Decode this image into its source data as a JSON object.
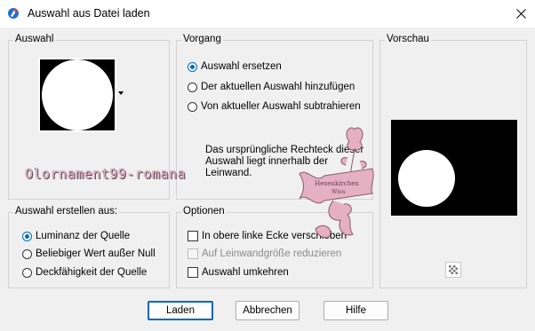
{
  "window": {
    "title": "Auswahl aus Datei laden"
  },
  "auswahl": {
    "title": "Auswahl",
    "dropdown_arrow": "caret-down-icon"
  },
  "vorgang": {
    "title": "Vorgang",
    "options": [
      {
        "label": "Auswahl ersetzen",
        "checked": true
      },
      {
        "label": "Der aktuellen Auswahl hinzufügen",
        "checked": false
      },
      {
        "label": "Von aktueller Auswahl subtrahieren",
        "checked": false
      }
    ],
    "info_line1": "Das ursprüngliche Rechteck dieser",
    "info_line2": "Auswahl liegt innerhalb der",
    "info_line3": "Leinwand."
  },
  "vorschau": {
    "title": "Vorschau",
    "zoom_icon": "checkerboard-icon"
  },
  "erstellen": {
    "title": "Auswahl erstellen aus:",
    "options": [
      {
        "label": "Luminanz der Quelle",
        "checked": true
      },
      {
        "label": "Beliebiger Wert außer Null",
        "checked": false
      },
      {
        "label": "Deckfähigkeit der Quelle",
        "checked": false
      }
    ]
  },
  "optionen": {
    "title": "Optionen",
    "checks": [
      {
        "label": "In obere linke Ecke verschieben",
        "checked": false,
        "disabled": false
      },
      {
        "label": "Auf Leinwandgröße reduzieren",
        "checked": false,
        "disabled": true
      },
      {
        "label": "Auswahl umkehren",
        "checked": false,
        "disabled": false
      }
    ]
  },
  "buttons": {
    "load": "Laden",
    "cancel": "Abbrechen",
    "help": "Hilfe"
  },
  "watermark": {
    "text": "Olornament99-romana",
    "logo_text_1": "Hexenkirchen",
    "logo_text_2": "Wien"
  },
  "colors": {
    "accent": "#0067c0",
    "watermark_pink": "#e5b0c2"
  }
}
